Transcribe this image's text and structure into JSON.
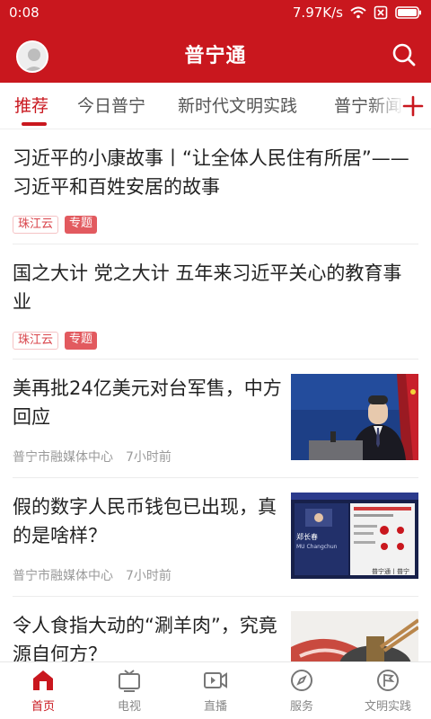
{
  "status": {
    "time": "0:08",
    "speed": "7.97K/s"
  },
  "header": {
    "title": "普宁通"
  },
  "tabs": [
    {
      "label": "推荐",
      "active": true
    },
    {
      "label": "今日普宁",
      "active": false
    },
    {
      "label": "新时代文明实践",
      "active": false
    },
    {
      "label": "普宁新闻",
      "active": false
    }
  ],
  "feed": [
    {
      "title": "习近平的小康故事丨“让全体人民住有所居”——习近平和百姓安居的故事",
      "source": "珠江云",
      "tag": "专题"
    },
    {
      "title": "国之大计 党之大计 五年来习近平关心的教育事业",
      "source": "珠江云",
      "tag": "专题"
    },
    {
      "title": "美再批24亿美元对台军售，中方回应",
      "source": "普宁市融媒体中心",
      "time": "7小时前"
    },
    {
      "title": "假的数字人民币钱包已出现，真的是啥样？",
      "source": "普宁市融媒体中心",
      "time": "7小时前"
    },
    {
      "title": "令人食指大动的“涮羊肉”，究竟源自何方？"
    }
  ],
  "thumb_text": {
    "slide_name": "郑长春",
    "slide_name_en": "MU Changchun",
    "watermark": "普宁通丨普宁"
  },
  "nav": [
    {
      "label": "首页",
      "icon": "home-icon",
      "active": true
    },
    {
      "label": "电视",
      "icon": "tv-icon",
      "active": false
    },
    {
      "label": "直播",
      "icon": "live-icon",
      "active": false
    },
    {
      "label": "服务",
      "icon": "compass-icon",
      "active": false
    },
    {
      "label": "文明实践",
      "icon": "flag-icon",
      "active": false
    }
  ],
  "colors": {
    "brand": "#c9171e",
    "tag_source": "#d9434a",
    "tag_topic_bg": "#e25a5f"
  }
}
